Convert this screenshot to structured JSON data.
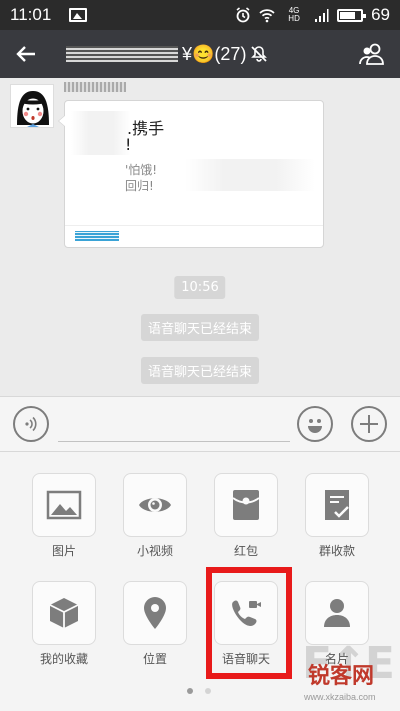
{
  "status_bar": {
    "time": "11:01",
    "battery": "69",
    "net_badge": "4G HD"
  },
  "chat_header": {
    "group_suffix": "¥😊(27)"
  },
  "messages": {
    "card": {
      "title_line1": ".携手",
      "title_line2": "!",
      "desc_line1": "'怕饿!",
      "desc_line2": "回归!"
    },
    "timestamp": "10:56",
    "system_1": "语音聊天已经结束",
    "system_2": "语音聊天已经结束"
  },
  "plus_panel": {
    "items": [
      {
        "label": "图片",
        "icon": "image-icon"
      },
      {
        "label": "小视频",
        "icon": "video-eye-icon"
      },
      {
        "label": "红包",
        "icon": "red-packet-icon"
      },
      {
        "label": "群收款",
        "icon": "group-collect-icon"
      },
      {
        "label": "我的收藏",
        "icon": "favorites-cube-icon"
      },
      {
        "label": "位置",
        "icon": "location-pin-icon"
      },
      {
        "label": "语音聊天",
        "icon": "voice-call-icon"
      },
      {
        "label": "名片",
        "icon": "contact-card-icon"
      }
    ],
    "current_page": 1,
    "page_count": 2
  },
  "colors": {
    "header": "#393a3f",
    "highlight": "#e81a1a",
    "icon": "#7d7d7d"
  },
  "watermark": {
    "main": "锐客网",
    "url": "www.xkzaiba.com"
  }
}
